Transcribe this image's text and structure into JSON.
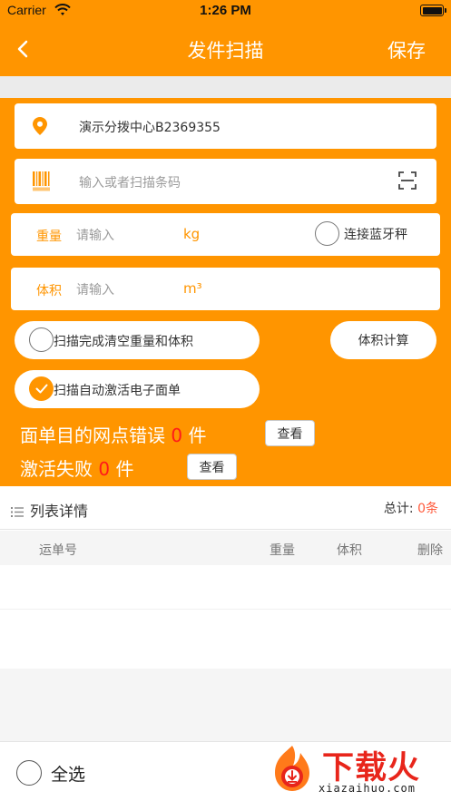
{
  "status_bar": {
    "carrier": "Carrier",
    "time": "1:26 PM"
  },
  "nav": {
    "title": "发件扫描",
    "save_label": "保存"
  },
  "location": {
    "value": "演示分拨中心B2369355"
  },
  "barcode": {
    "placeholder": "输入或者扫描条码"
  },
  "weight": {
    "label": "重量",
    "placeholder": "请输入",
    "unit": "kg",
    "bluetooth_label": "连接蓝牙秤",
    "bluetooth_checked": false
  },
  "volume": {
    "label": "体积",
    "placeholder": "请输入",
    "unit": "m³"
  },
  "options": {
    "clear_after_scan": {
      "label": "扫描完成清空重量和体积",
      "checked": false
    },
    "auto_activate": {
      "label": "扫描自动激活电子面单",
      "checked": true
    },
    "volume_calc_label": "体积计算"
  },
  "stats": {
    "wrong_outlet": {
      "prefix": "面单目的网点错误",
      "count": "0",
      "suffix": "件",
      "button": "查看"
    },
    "activation_failed": {
      "prefix": "激活失败",
      "count": "0",
      "suffix": "件",
      "button": "查看"
    }
  },
  "list": {
    "title": "列表详情",
    "total_label": "总计:",
    "total_count": "0条",
    "columns": [
      "运单号",
      "重量",
      "体积",
      "删除"
    ]
  },
  "footer": {
    "select_all_label": "全选"
  },
  "watermark": {
    "title": "下载火",
    "url": "xiazaihuo.com"
  },
  "colors": {
    "accent": "#ff9500",
    "alert": "#ff1a1a",
    "count": "#ff5a3c"
  }
}
